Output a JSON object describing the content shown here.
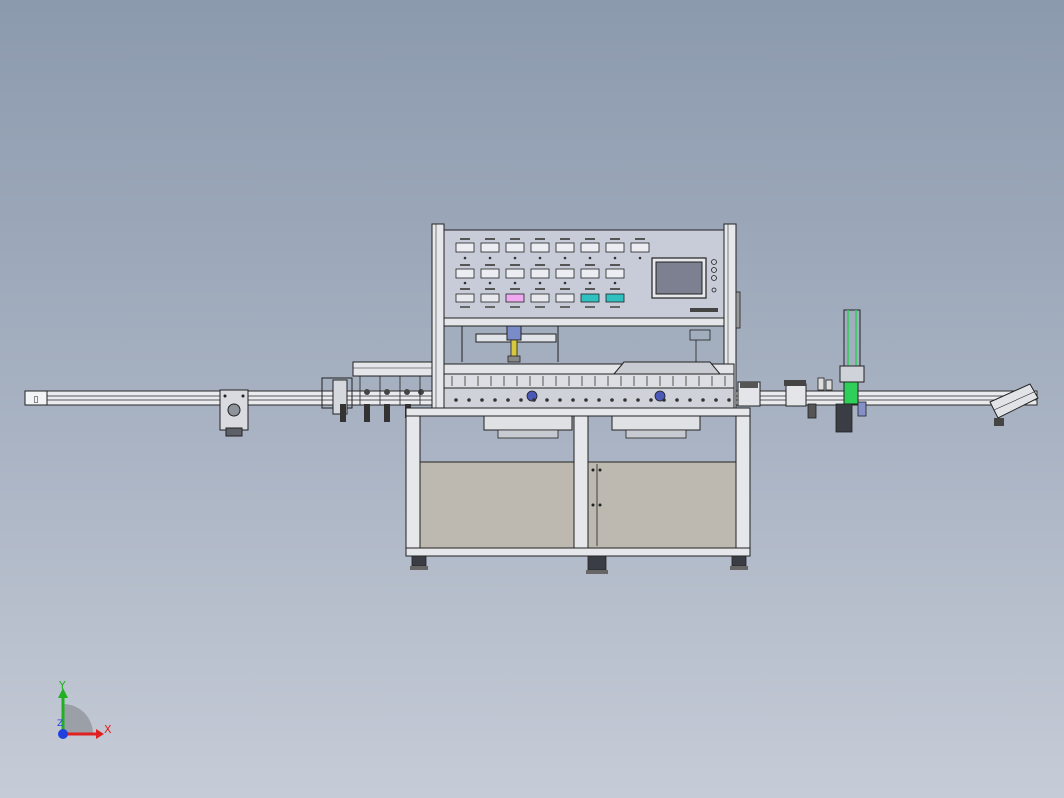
{
  "viewport": {
    "background_top": "#8c9aae",
    "background_bottom": "#c6ccd7"
  },
  "triad": {
    "x_label": "X",
    "y_label": "Y",
    "z_label": "Z",
    "x_color": "#e02020",
    "y_color": "#20b020",
    "z_color": "#2040e0"
  },
  "machine": {
    "accent_green": "#2fd05a",
    "accent_pink": "#f0a8f0",
    "accent_teal": "#30c0c0",
    "screen_color": "#7c8090",
    "panel_color": "#c8ccd8",
    "cabinet_color": "#bdb9b0"
  }
}
